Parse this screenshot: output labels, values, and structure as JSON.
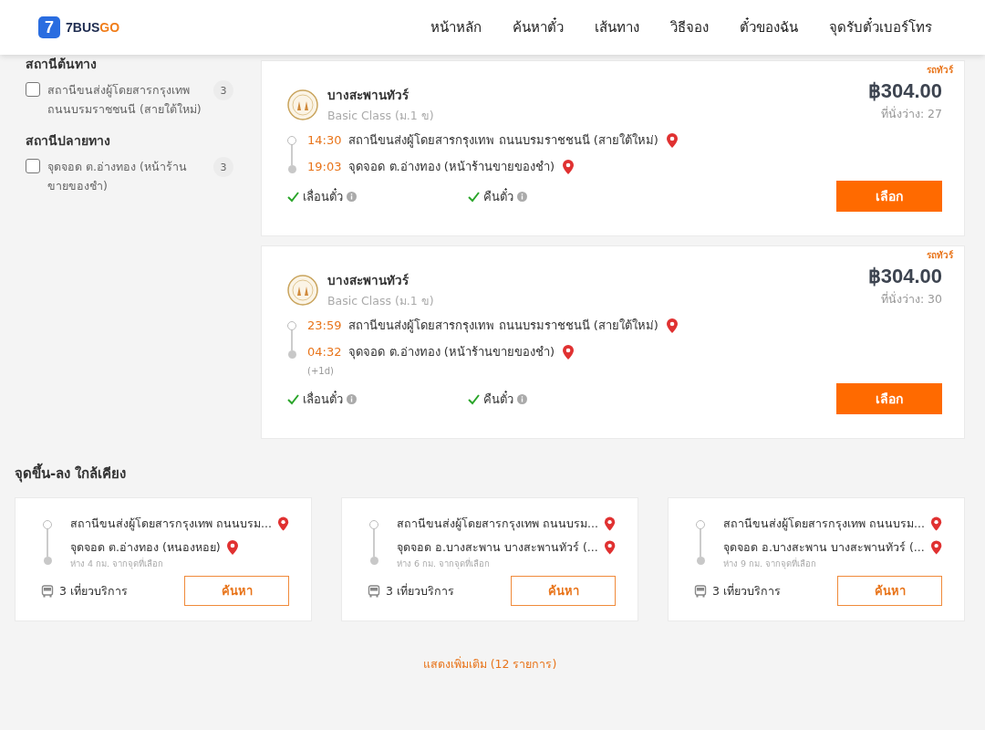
{
  "header": {
    "logo": {
      "digit": "7",
      "brand_left": "7BUS",
      "brand_right": "GO"
    },
    "nav": [
      {
        "label": "หน้าหลัก"
      },
      {
        "label": "ค้นหาตั๋ว"
      },
      {
        "label": "เส้นทาง"
      },
      {
        "label": "วิธีจอง"
      },
      {
        "label": "ตั๋วของฉัน"
      },
      {
        "label": "จุดรับตั๋วเบอร์โทร"
      }
    ]
  },
  "sidebar": {
    "groups": [
      {
        "title": "สถานีต้นทาง",
        "options": [
          {
            "label": "สถานีขนส่งผู้โดยสารกรุงเทพ ถนนบรมราชชนนี (สายใต้ใหม่)",
            "count": "3",
            "checked": false
          }
        ]
      },
      {
        "title": "สถานีปลายทาง",
        "options": [
          {
            "label": "จุดจอด ต.อ่างทอง (หน้าร้านขายของชำ)",
            "count": "3",
            "checked": false
          }
        ]
      }
    ]
  },
  "trips": [
    {
      "tag": "รถทัวร์",
      "operator": "บางสะพานทัวร์",
      "bus_class": "Basic Class (ม.1 ข)",
      "price": "฿304.00",
      "seats": "ที่นั่งว่าง: 27",
      "depart_time": "14:30",
      "depart_station": "สถานีขนส่งผู้โดยสารกรุงเทพ ถนนบรมราชชนนี (สายใต้ใหม่)",
      "arrive_time": "19:03",
      "arrive_station": "จุดจอด ต.อ่างทอง (หน้าร้านขายของชำ)",
      "features": [
        {
          "label": "เลื่อนตั๋ว",
          "available": true
        },
        {
          "label": "คืนตั๋ว",
          "available": true
        }
      ],
      "button": "เลือก"
    },
    {
      "tag": "รถทัวร์",
      "operator": "บางสะพานทัวร์",
      "bus_class": "Basic Class (ม.1 ข)",
      "price": "฿304.00",
      "seats": "ที่นั่งว่าง: 30",
      "depart_time": "23:59",
      "depart_station": "สถานีขนส่งผู้โดยสารกรุงเทพ ถนนบรมราชชนนี (สายใต้ใหม่)",
      "arrive_time": "04:32",
      "next_day": "(+1d)",
      "arrive_station": "จุดจอด ต.อ่างทอง (หน้าร้านขายของชำ)",
      "features": [
        {
          "label": "เลื่อนตั๋ว",
          "available": true
        },
        {
          "label": "คืนตั๋ว",
          "available": true
        }
      ],
      "button": "เลือก"
    }
  ],
  "nearby": {
    "title": "จุดขึ้น-ลง ใกล้เคียง",
    "cards": [
      {
        "from": "สถานีขนส่งผู้โดยสารกรุงเทพ ถนนบรม...",
        "to": "จุดจอด ต.อ่างทอง (หนองหอย)",
        "distance": "ห่าง 4 กม. จากจุดที่เลือก",
        "trips": "3 เที่ยวบริการ",
        "button": "ค้นหา"
      },
      {
        "from": "สถานีขนส่งผู้โดยสารกรุงเทพ ถนนบรม...",
        "to": "จุดจอด อ.บางสะพาน บางสะพานทัวร์ (...",
        "distance": "ห่าง 6 กม. จากจุดที่เลือก",
        "trips": "3 เที่ยวบริการ",
        "button": "ค้นหา"
      },
      {
        "from": "สถานีขนส่งผู้โดยสารกรุงเทพ ถนนบรม...",
        "to": "จุดจอด อ.บางสะพาน บางสะพานทัวร์ (...",
        "distance": "ห่าง 9 กม. จากจุดที่เลือก",
        "trips": "3 เที่ยวบริการ",
        "button": "ค้นหา"
      }
    ]
  },
  "show_more": "แสดงเพิ่มเติม (12 รายการ)"
}
